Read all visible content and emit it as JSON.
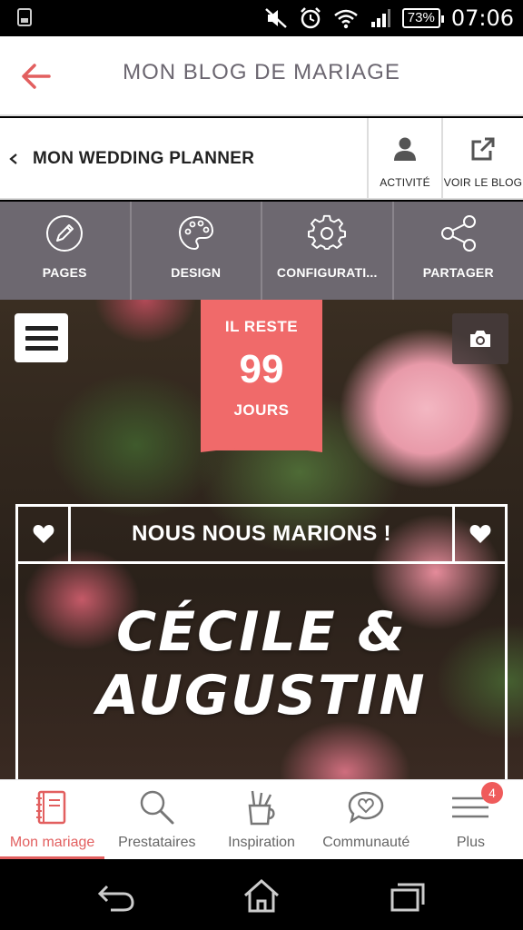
{
  "status_bar": {
    "battery": "73%",
    "time": "07:06",
    "icons": [
      "sim-icon",
      "mute-icon",
      "alarm-icon",
      "wifi-icon",
      "signal-icon",
      "battery-icon"
    ]
  },
  "header": {
    "title": "MON BLOG DE MARIAGE",
    "back_icon": "arrow-left-icon"
  },
  "sub_nav": {
    "planner_label": "MON WEDDING PLANNER",
    "activity_label": "ACTIVITÉ",
    "view_blog_label": "VOIR LE BLOG"
  },
  "toolbar": {
    "items": [
      {
        "label": "PAGES",
        "icon": "pencil-icon"
      },
      {
        "label": "DESIGN",
        "icon": "palette-icon"
      },
      {
        "label": "CONFIGURATI...",
        "icon": "gear-icon"
      },
      {
        "label": "PARTAGER",
        "icon": "share-icon"
      }
    ]
  },
  "hero": {
    "countdown": {
      "top": "IL RESTE",
      "number": "99",
      "bottom": "JOURS"
    },
    "headline": "NOUS NOUS MARIONS !",
    "names_line1": "CÉCILE &",
    "names_line2": "AUGUSTIN"
  },
  "bottom_nav": {
    "items": [
      {
        "label": "Mon mariage",
        "icon": "notebook-icon",
        "active": true
      },
      {
        "label": "Prestataires",
        "icon": "search-icon",
        "active": false
      },
      {
        "label": "Inspiration",
        "icon": "pencil-cup-icon",
        "active": false
      },
      {
        "label": "Communauté",
        "icon": "chat-heart-icon",
        "active": false
      },
      {
        "label": "Plus",
        "icon": "menu-icon",
        "active": false,
        "badge": "4"
      }
    ]
  },
  "colors": {
    "accent": "#e25f5f",
    "toolbar": "#6d6870",
    "countdown": "#f06a6a"
  }
}
